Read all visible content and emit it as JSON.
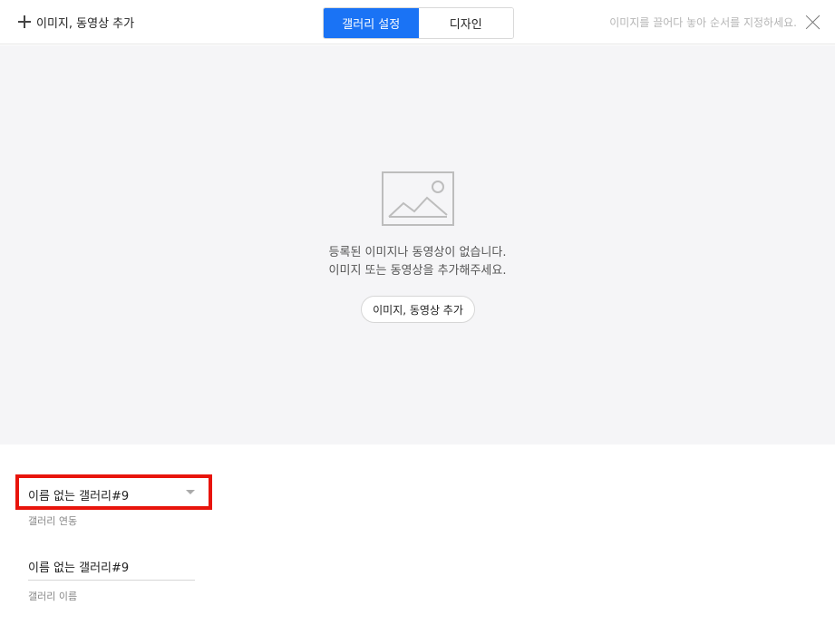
{
  "header": {
    "add_media_label": "이미지, 동영상 추가",
    "tabs": [
      {
        "label": "갤러리 설정",
        "active": true
      },
      {
        "label": "디자인",
        "active": false
      }
    ],
    "hint": "이미지를 끌어다 놓아 순서를 지정하세요.",
    "close_icon": "close-icon"
  },
  "stage": {
    "empty_icon": "image-placeholder-icon",
    "message_line1": "등록된 이미지나 동영상이 없습니다.",
    "message_line2": "이미지 또는 동영상을 추가해주세요.",
    "add_button_label": "이미지, 동영상 추가"
  },
  "settings": {
    "gallery_link": {
      "selected": "이름 없는 갤러리#9",
      "caption": "갤러리 연동"
    },
    "gallery_name": {
      "value": "이름 없는 갤러리#9",
      "caption": "갤러리 이름"
    }
  },
  "colors": {
    "accent": "#1a73f5",
    "highlight": "#e8140c",
    "stage_bg": "#f5f5f7"
  }
}
